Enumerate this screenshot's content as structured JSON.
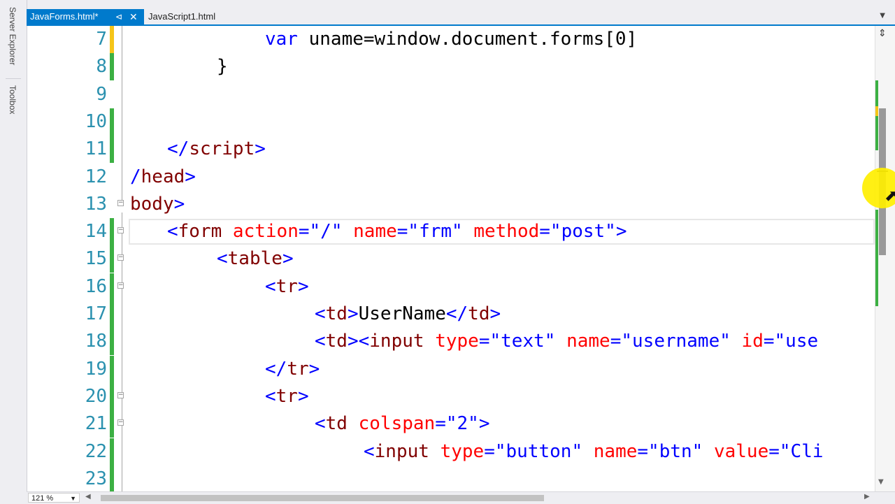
{
  "sidebar": {
    "tabs": [
      {
        "label": "Server Explorer"
      },
      {
        "label": "Toolbox"
      }
    ]
  },
  "tabs": [
    {
      "label": "JavaForms.html*",
      "pin_icon": "pin-icon",
      "close_icon": "close-icon",
      "active": true
    },
    {
      "label": "JavaScript1.html",
      "active": false
    }
  ],
  "editor": {
    "lines": [
      {
        "num": "7",
        "tokens": [
          {
            "t": "var",
            "c": "kw"
          },
          {
            "t": " uname=window.document.forms[0]",
            "c": "tx"
          }
        ]
      },
      {
        "num": "8",
        "tokens": [
          {
            "t": "}",
            "c": "tx"
          }
        ]
      },
      {
        "num": "9",
        "tokens": []
      },
      {
        "num": "10",
        "tokens": []
      },
      {
        "num": "11",
        "tokens": [
          {
            "t": "</",
            "c": "dm"
          },
          {
            "t": "script",
            "c": "tg"
          },
          {
            "t": ">",
            "c": "dm"
          }
        ]
      },
      {
        "num": "12",
        "tokens": [
          {
            "t": "/",
            "c": "dm"
          },
          {
            "t": "head",
            "c": "tg"
          },
          {
            "t": ">",
            "c": "dm"
          }
        ]
      },
      {
        "num": "13",
        "tokens": [
          {
            "t": "body",
            "c": "tg"
          },
          {
            "t": ">",
            "c": "dm"
          }
        ]
      },
      {
        "num": "14",
        "tokens": [
          {
            "t": "<",
            "c": "dm"
          },
          {
            "t": "form",
            "c": "tg"
          },
          {
            "t": " action",
            "c": "at"
          },
          {
            "t": "=\"/\"",
            "c": "av"
          },
          {
            "t": " name",
            "c": "at"
          },
          {
            "t": "=\"frm\"",
            "c": "av"
          },
          {
            "t": " method",
            "c": "at"
          },
          {
            "t": "=\"post\"",
            "c": "av"
          },
          {
            "t": ">",
            "c": "dm"
          }
        ]
      },
      {
        "num": "15",
        "tokens": [
          {
            "t": "<",
            "c": "dm"
          },
          {
            "t": "table",
            "c": "tg"
          },
          {
            "t": ">",
            "c": "dm"
          }
        ]
      },
      {
        "num": "16",
        "tokens": [
          {
            "t": "<",
            "c": "dm"
          },
          {
            "t": "tr",
            "c": "tg"
          },
          {
            "t": ">",
            "c": "dm"
          }
        ]
      },
      {
        "num": "17",
        "tokens": [
          {
            "t": "<",
            "c": "dm"
          },
          {
            "t": "td",
            "c": "tg"
          },
          {
            "t": ">",
            "c": "dm"
          },
          {
            "t": "UserName",
            "c": "tx"
          },
          {
            "t": "</",
            "c": "dm"
          },
          {
            "t": "td",
            "c": "tg"
          },
          {
            "t": ">",
            "c": "dm"
          }
        ]
      },
      {
        "num": "18",
        "tokens": [
          {
            "t": "<",
            "c": "dm"
          },
          {
            "t": "td",
            "c": "tg"
          },
          {
            "t": "><",
            "c": "dm"
          },
          {
            "t": "input",
            "c": "tg"
          },
          {
            "t": " type",
            "c": "at"
          },
          {
            "t": "=\"text\"",
            "c": "av"
          },
          {
            "t": " name",
            "c": "at"
          },
          {
            "t": "=\"username\"",
            "c": "av"
          },
          {
            "t": " id",
            "c": "at"
          },
          {
            "t": "=\"use",
            "c": "av"
          }
        ]
      },
      {
        "num": "19",
        "tokens": [
          {
            "t": "</",
            "c": "dm"
          },
          {
            "t": "tr",
            "c": "tg"
          },
          {
            "t": ">",
            "c": "dm"
          }
        ]
      },
      {
        "num": "20",
        "tokens": [
          {
            "t": "<",
            "c": "dm"
          },
          {
            "t": "tr",
            "c": "tg"
          },
          {
            "t": ">",
            "c": "dm"
          }
        ]
      },
      {
        "num": "21",
        "tokens": [
          {
            "t": "<",
            "c": "dm"
          },
          {
            "t": "td",
            "c": "tg"
          },
          {
            "t": " colspan",
            "c": "at"
          },
          {
            "t": "=\"2\"",
            "c": "av"
          },
          {
            "t": ">",
            "c": "dm"
          }
        ]
      },
      {
        "num": "22",
        "tokens": [
          {
            "t": "<",
            "c": "dm"
          },
          {
            "t": "input",
            "c": "tg"
          },
          {
            "t": " type",
            "c": "at"
          },
          {
            "t": "=\"button\"",
            "c": "av"
          },
          {
            "t": " name",
            "c": "at"
          },
          {
            "t": "=\"btn\"",
            "c": "av"
          },
          {
            "t": " value",
            "c": "at"
          },
          {
            "t": "=\"Cli",
            "c": "av"
          }
        ]
      },
      {
        "num": "23",
        "tokens": []
      }
    ]
  },
  "statusbar": {
    "zoom": "121 %"
  },
  "colors": {
    "accent": "#007acc",
    "line_number": "#2b91af",
    "keyword": "#0000ff",
    "tag": "#800000",
    "attribute": "#ff0000",
    "change_saved": "#3cb043",
    "change_unsaved": "#f5c518"
  }
}
